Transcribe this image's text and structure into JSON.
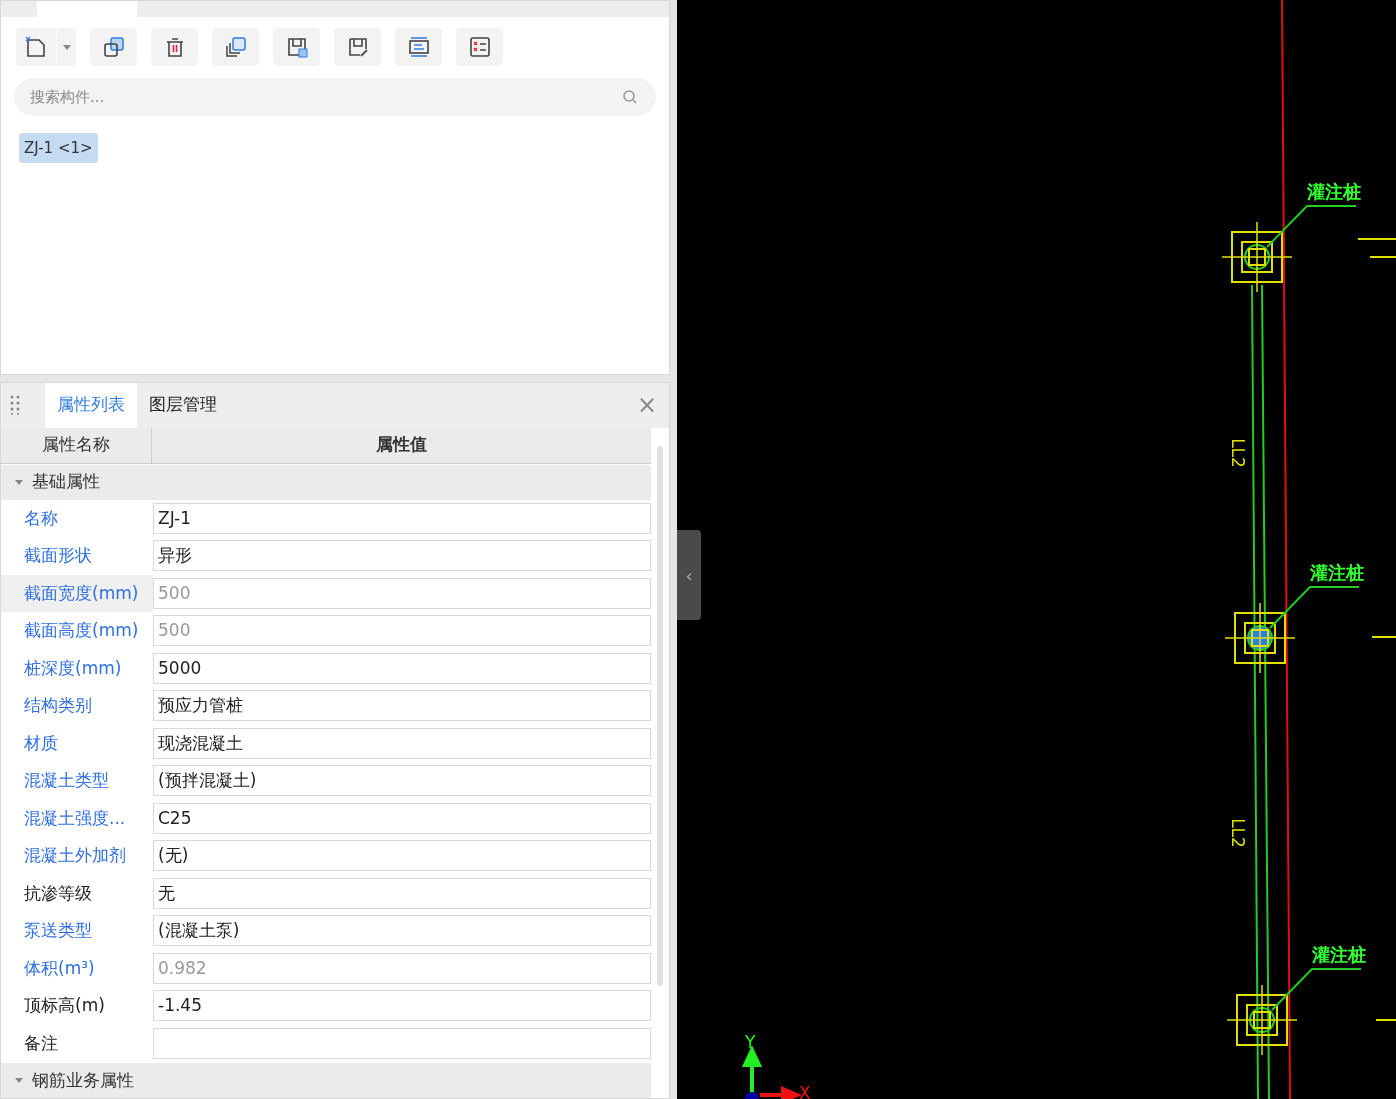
{
  "component_panel": {
    "toolbar": [
      {
        "kind": "new",
        "dropdown": true
      },
      {
        "kind": "copy",
        "dropdown": false
      },
      {
        "kind": "delete",
        "dropdown": false
      },
      {
        "kind": "layer-copy",
        "dropdown": false
      },
      {
        "kind": "save-image",
        "dropdown": false
      },
      {
        "kind": "pick",
        "dropdown": false
      },
      {
        "kind": "list",
        "dropdown": false
      },
      {
        "kind": "checklist",
        "dropdown": false
      }
    ],
    "search": {
      "placeholder": "搜索构件..."
    },
    "components": [
      {
        "label": "ZJ-1 <1>",
        "selected": true
      }
    ]
  },
  "property_panel": {
    "tabs": [
      {
        "label": "属性列表",
        "selected": true
      },
      {
        "label": "图层管理",
        "selected": false
      }
    ],
    "close": "×",
    "columns": [
      "属性名称",
      "属性值"
    ],
    "sections": [
      {
        "title": "基础属性",
        "expanded": true,
        "rows": [
          {
            "name": "名称",
            "value": "ZJ-1",
            "highlighted": true,
            "disabled": false,
            "hovered": false
          },
          {
            "name": "截面形状",
            "value": "异形",
            "highlighted": true,
            "disabled": false,
            "hovered": false
          },
          {
            "name": "截面宽度(mm)",
            "value": "500",
            "highlighted": true,
            "disabled": true,
            "hovered": true
          },
          {
            "name": "截面高度(mm)",
            "value": "500",
            "highlighted": true,
            "disabled": true,
            "hovered": false
          },
          {
            "name": "桩深度(mm)",
            "value": "5000",
            "highlighted": true,
            "disabled": false,
            "hovered": false
          },
          {
            "name": "结构类别",
            "value": "预应力管桩",
            "highlighted": true,
            "disabled": false,
            "hovered": false
          },
          {
            "name": "材质",
            "value": "现浇混凝土",
            "highlighted": true,
            "disabled": false,
            "hovered": false
          },
          {
            "name": "混凝土类型",
            "value": "(预拌混凝土)",
            "highlighted": true,
            "disabled": false,
            "hovered": false
          },
          {
            "name": "混凝土强度...",
            "value": "C25",
            "highlighted": true,
            "disabled": false,
            "hovered": false
          },
          {
            "name": "混凝土外加剂",
            "value": "(无)",
            "highlighted": true,
            "disabled": false,
            "hovered": false
          },
          {
            "name": "抗渗等级",
            "value": "无",
            "highlighted": false,
            "disabled": false,
            "hovered": false
          },
          {
            "name": "泵送类型",
            "value": "(混凝土泵)",
            "highlighted": true,
            "disabled": false,
            "hovered": false
          },
          {
            "name": "体积(m³)",
            "value": "0.982",
            "highlighted": true,
            "disabled": true,
            "hovered": false
          },
          {
            "name": "顶标高(m)",
            "value": "-1.45",
            "highlighted": false,
            "disabled": false,
            "hovered": false
          },
          {
            "name": "备注",
            "value": "",
            "highlighted": false,
            "disabled": false,
            "hovered": false
          }
        ]
      },
      {
        "title": "钢筋业务属性",
        "expanded": true
      }
    ]
  },
  "canvas": {
    "collapse_handle": "‹",
    "piles": [
      {
        "label": "灌注桩",
        "selected": false
      },
      {
        "label": "灌注桩",
        "selected": true
      },
      {
        "label": "灌注桩",
        "selected": false
      }
    ],
    "beam_labels": [
      "LL2",
      "LL2"
    ],
    "axes": {
      "y": "Y",
      "x": "X"
    }
  }
}
